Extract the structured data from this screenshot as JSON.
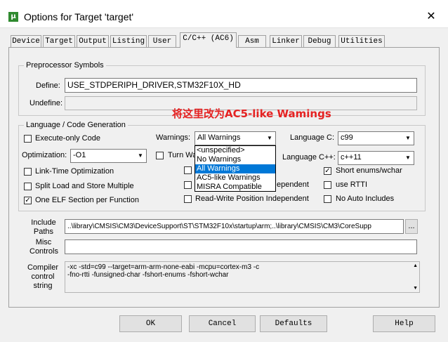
{
  "window": {
    "title": "Options for Target 'target'",
    "close": "✕",
    "app_icon": "keil-uvision-icon"
  },
  "tabs": [
    "Device",
    "Target",
    "Output",
    "Listing",
    "User",
    "C/C++ (AC6)",
    "Asm",
    "Linker",
    "Debug",
    "Utilities"
  ],
  "active_tab": "C/C++ (AC6)",
  "preprocessor": {
    "title": "Preprocessor Symbols",
    "define_label": "Define:",
    "define_value": "USE_STDPERIPH_DRIVER,STM32F10X_HD",
    "undefine_label": "Undefine:",
    "undefine_value": ""
  },
  "annotation": "将这里改为AC5-like Wamings",
  "language": {
    "title": "Language / Code Generation",
    "execute_only": {
      "label": "Execute-only Code",
      "checked": false
    },
    "warnings_label": "Warnings:",
    "warnings_value": "All Warnings",
    "warnings_options": [
      "<unspecified>",
      "No Warnings",
      "All Warnings",
      "AC5-like Warnings",
      "MISRA Compatible"
    ],
    "warnings_selected_index": 2,
    "language_c_label": "Language C:",
    "language_c_value": "c99",
    "optimization_label": "Optimization:",
    "optimization_value": "-O1",
    "turn_warnings_label": "Turn Wa",
    "language_cpp_label": "Language C++:",
    "language_cpp_value": "c++11",
    "lto": {
      "label": "Link-Time Optimization",
      "checked": false
    },
    "short_enums": {
      "label": "Short enums/wchar",
      "checked": true
    },
    "split_load": {
      "label": "Split Load and Store Multiple",
      "checked": false
    },
    "rw_independent_partial": "ependent",
    "use_rtti": {
      "label": "use RTTI",
      "checked": false
    },
    "one_elf": {
      "label": "One ELF Section per Function",
      "checked": true
    },
    "rw_position": {
      "label": "Read-Write Position Independent",
      "checked": false
    },
    "no_auto_includes": {
      "label": "No Auto Includes",
      "checked": false
    }
  },
  "include_paths": {
    "label_line1": "Include",
    "label_line2": "Paths",
    "value": "..\\library\\CMSIS\\CM3\\DeviceSupport\\ST\\STM32F10x\\startup\\arm;..\\library\\CMSIS\\CM3\\CoreSupp",
    "browse": "..."
  },
  "misc": {
    "label_line1": "Misc",
    "label_line2": "Controls",
    "value": ""
  },
  "compiler_string": {
    "label_line1": "Compiler",
    "label_line2": "control",
    "label_line3": "string",
    "line1": "-xc -std=c99 --target=arm-arm-none-eabi -mcpu=cortex-m3 -c",
    "line2": "-fno-rtti -funsigned-char -fshort-enums -fshort-wchar"
  },
  "buttons": {
    "ok": "OK",
    "cancel": "Cancel",
    "defaults": "Defaults",
    "help": "Help"
  }
}
